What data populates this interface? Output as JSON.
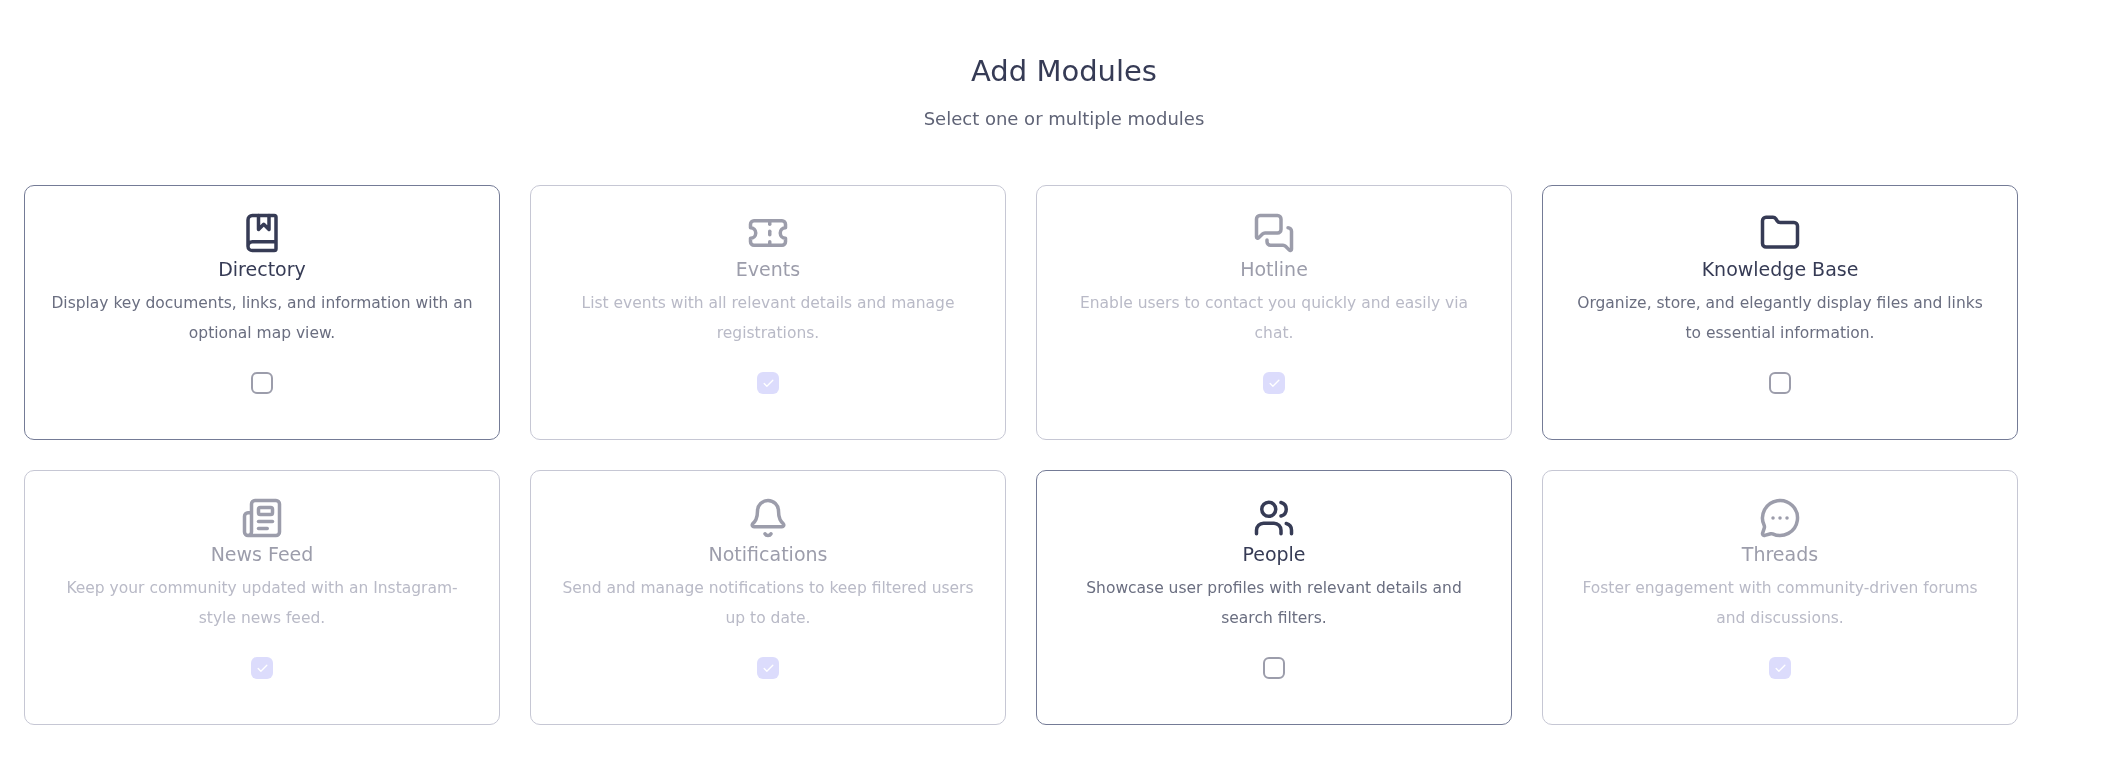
{
  "header": {
    "title": "Add Modules",
    "subtitle": "Select one or multiple modules"
  },
  "modules": [
    {
      "name": "Directory",
      "description": "Display key documents, links, and information with an optional map view.",
      "checked": false
    },
    {
      "name": "Events",
      "description": "List events with all relevant details and manage registrations.",
      "checked": true
    },
    {
      "name": "Hotline",
      "description": "Enable users to contact you quickly and easily via chat.",
      "checked": true
    },
    {
      "name": "Knowledge Base",
      "description": "Organize, store, and elegantly display files and links to essential information.",
      "checked": false
    },
    {
      "name": "News Feed",
      "description": "Keep your community updated with an Instagram-style news feed.",
      "checked": true
    },
    {
      "name": "Notifications",
      "description": "Send and manage notifications to keep filtered users up to date.",
      "checked": true
    },
    {
      "name": "People",
      "description": "Showcase user profiles with relevant details and search filters.",
      "checked": false
    },
    {
      "name": "Threads",
      "description": "Foster engagement with community-driven forums and discussions.",
      "checked": true
    }
  ]
}
